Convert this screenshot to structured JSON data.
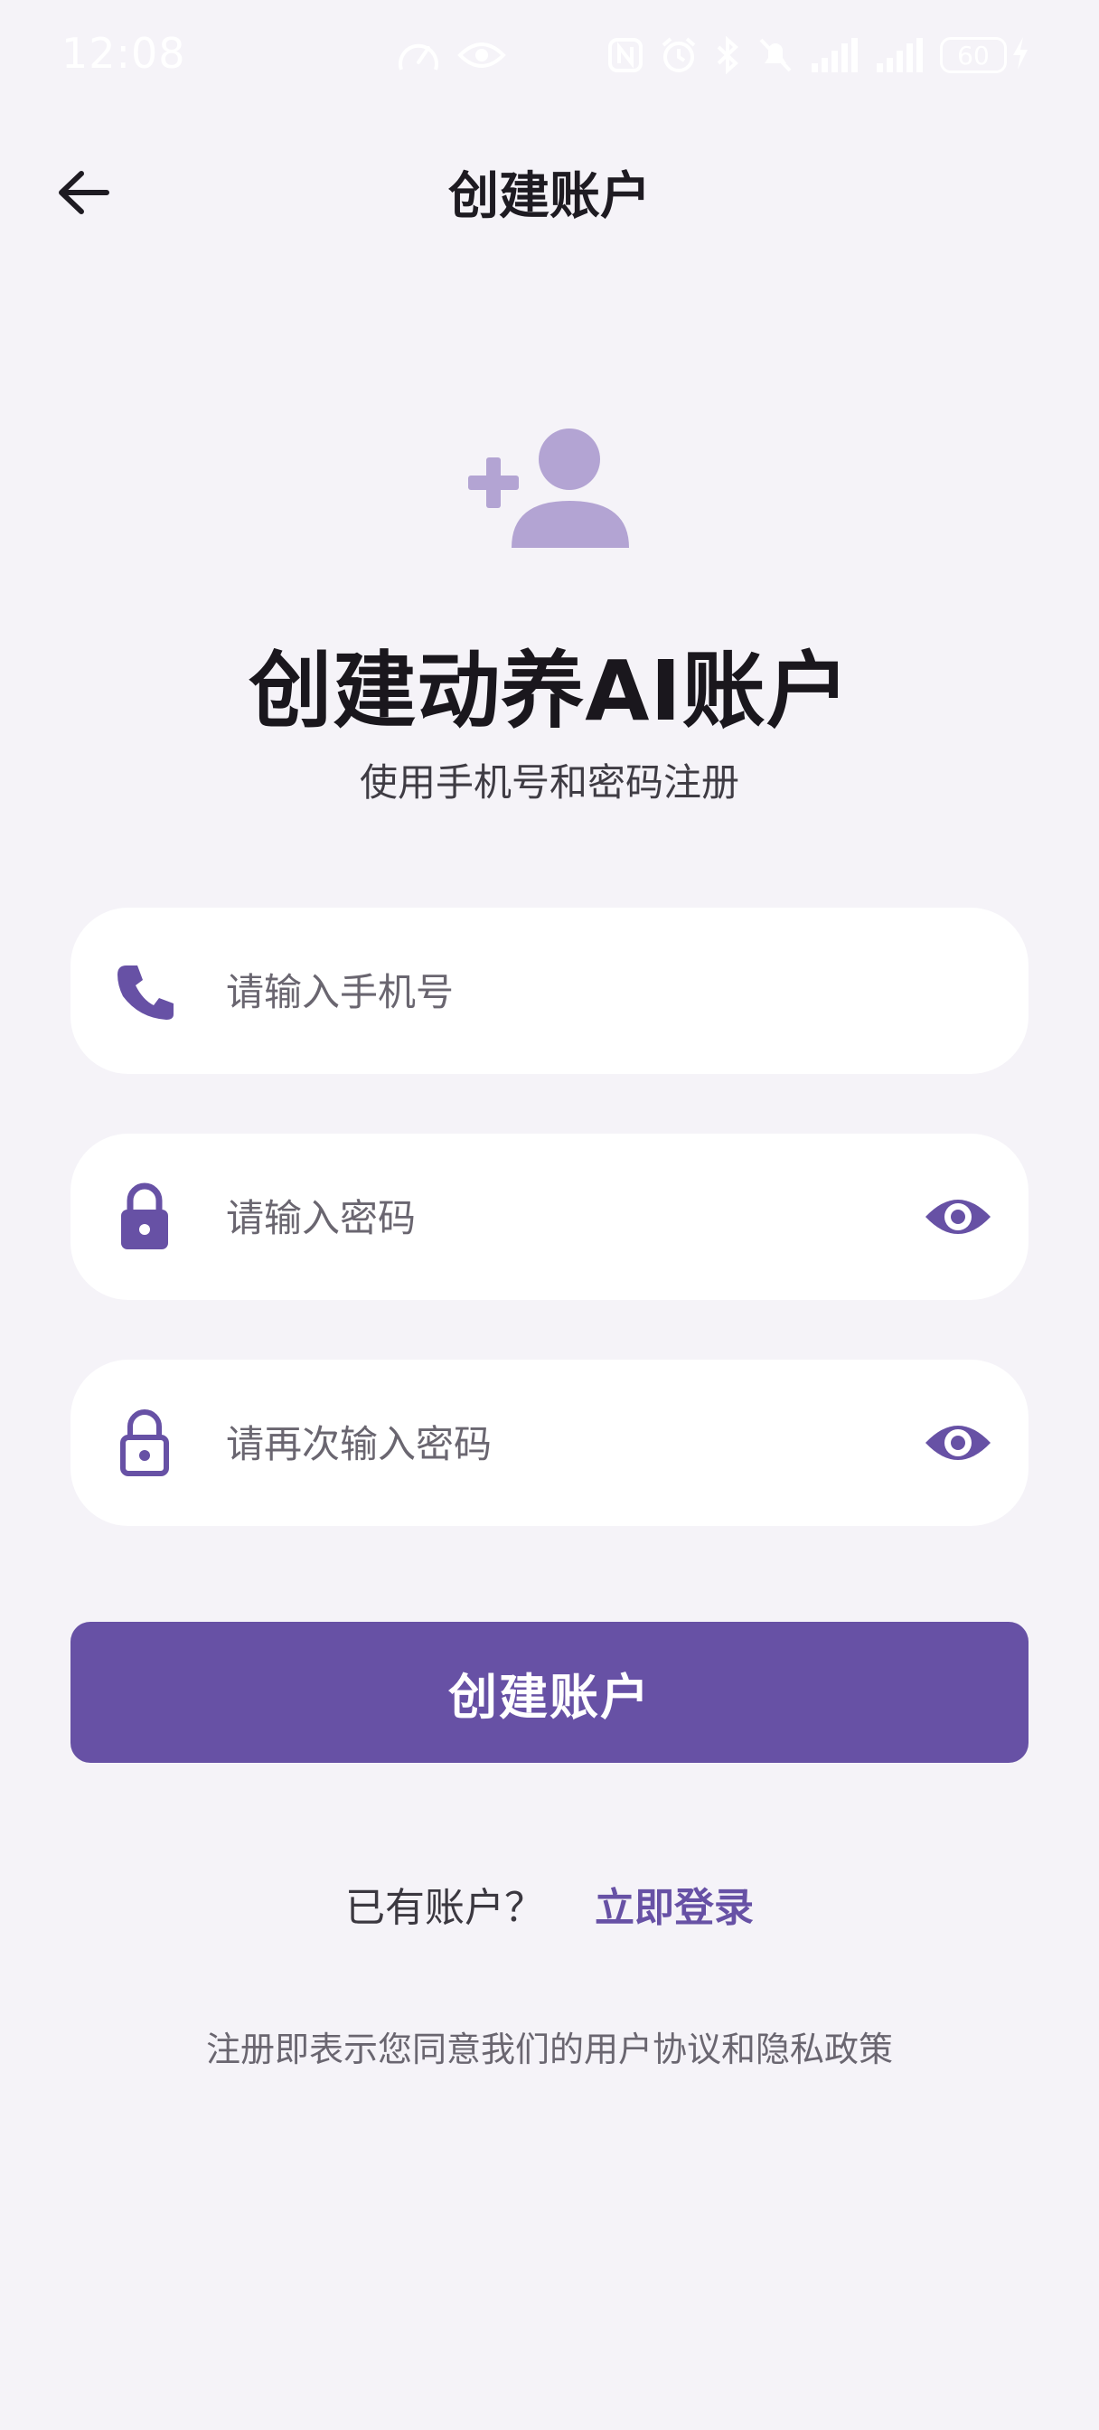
{
  "status_bar": {
    "time": "12:08",
    "battery": "60",
    "icons": [
      "speed-icon",
      "eye-icon",
      "nfc-icon",
      "alarm-icon",
      "bluetooth-icon",
      "mute-icon",
      "signal-icon",
      "signal-icon",
      "charging-icon"
    ]
  },
  "header": {
    "title": "创建账户",
    "back_icon": "arrow-left-icon"
  },
  "hero": {
    "icon": "add-person-icon",
    "title": "创建动养AI账户",
    "subtitle": "使用手机号和密码注册"
  },
  "form": {
    "phone": {
      "placeholder": "请输入手机号",
      "value": "",
      "icon": "phone-icon"
    },
    "password": {
      "placeholder": "请输入密码",
      "value": "",
      "icon": "lock-icon",
      "toggle_icon": "eye-icon"
    },
    "confirm_password": {
      "placeholder": "请再次输入密码",
      "value": "",
      "icon": "lock-outline-icon",
      "toggle_icon": "eye-icon"
    },
    "submit_label": "创建账户"
  },
  "login": {
    "prompt": "已有账户？",
    "link": "立即登录"
  },
  "terms": "注册即表示您同意我们的用户协议和隐私政策",
  "colors": {
    "background": "#f5f3f8",
    "accent": "#6751a5",
    "hero_icon": "#b3a4d3",
    "field_bg": "#ffffff"
  }
}
